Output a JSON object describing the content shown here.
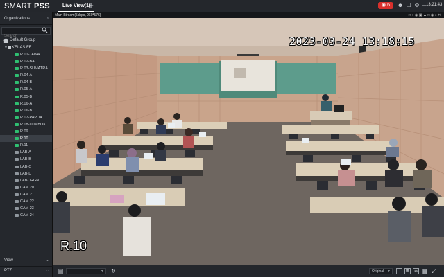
{
  "app": {
    "logo_prefix": "SMART ",
    "logo_bold": "PSS",
    "tab_label": "Live View(1)",
    "add_tab_glyph": "+",
    "alarm_count": "6",
    "clock": "13:21:43"
  },
  "sidebar": {
    "organizations_label": "Organizations",
    "search_placeholder": "Search",
    "root_label": "Default Group",
    "group_label": "KELAS FF",
    "cameras": [
      {
        "label": "R.01-JAWA",
        "online": true
      },
      {
        "label": "R.02-BALI",
        "online": true
      },
      {
        "label": "R.03-SUMATRA",
        "online": true
      },
      {
        "label": "R.04-A",
        "online": true
      },
      {
        "label": "R.04-B",
        "online": true
      },
      {
        "label": "R.05-A",
        "online": true
      },
      {
        "label": "R.05-B",
        "online": true
      },
      {
        "label": "R.06-A",
        "online": true
      },
      {
        "label": "R.06-B",
        "online": true
      },
      {
        "label": "R.07-PAPUA",
        "online": true
      },
      {
        "label": "R.08-LOMBOK",
        "online": true
      },
      {
        "label": "R.09",
        "online": true
      },
      {
        "label": "R.10",
        "online": true,
        "selected": true
      },
      {
        "label": "R.11",
        "online": true
      },
      {
        "label": "LAB-A",
        "online": false
      },
      {
        "label": "LAB-B",
        "online": false
      },
      {
        "label": "LAB-C",
        "online": false
      },
      {
        "label": "LAB-D",
        "online": false
      },
      {
        "label": "LAB-JRGN",
        "online": false
      },
      {
        "label": "CAM 20",
        "online": false
      },
      {
        "label": "CAM 21",
        "online": false
      },
      {
        "label": "CAM 22",
        "online": false
      },
      {
        "label": "CAM 23",
        "online": false
      },
      {
        "label": "CAM 24",
        "online": false
      }
    ],
    "view_label": "View",
    "ptz_label": "PTZ"
  },
  "viewer": {
    "stream_label": "Main Stream(5kbps, 960*576)",
    "osd_timestamp": "2023-03-24 13:18:15",
    "osd_channel_name": "R.10"
  },
  "bottombar": {
    "channel_select_value": "--",
    "aspect_value": "Original",
    "layout_16_label": "16"
  },
  "colors": {
    "online_camera": "#2fbf71",
    "offline_camera": "#8f969d",
    "alarm": "#d9302c",
    "selected_row": "#3a3f46"
  }
}
